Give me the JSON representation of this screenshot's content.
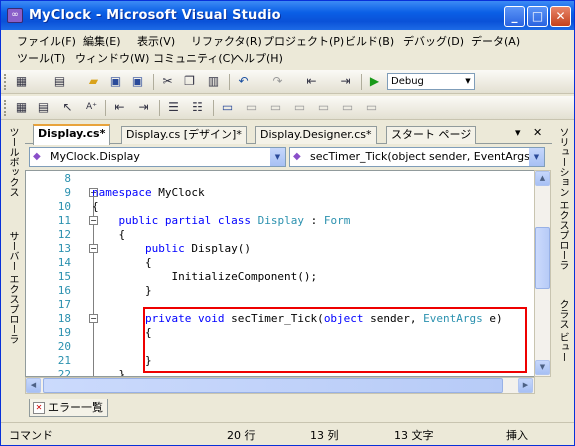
{
  "window": {
    "title": "MyClock - Microsoft Visual Studio",
    "minimize": "_",
    "maximize": "□",
    "close": "✕"
  },
  "menu": {
    "row1": [
      "ファイル(F)",
      "編集(E)",
      "表示(V)",
      "リファクタ(R)",
      "プロジェクト(P)",
      "ビルド(B)",
      "デバッグ(D)",
      "データ(A)"
    ],
    "row2": [
      "ツール(T)",
      "ウィンドウ(W)",
      "コミュニティ(C)",
      "ヘルプ(H)"
    ]
  },
  "toolbar": {
    "configuration": "Debug"
  },
  "tabs": [
    {
      "label": "Display.cs*",
      "active": true
    },
    {
      "label": "Display.cs [デザイン]*",
      "active": false
    },
    {
      "label": "Display.Designer.cs*",
      "active": false
    },
    {
      "label": "スタート ページ",
      "active": false
    }
  ],
  "tab_controls": {
    "dropdown": "▾",
    "close": "✕"
  },
  "navigation": {
    "type_combo": "MyClock.Display",
    "member_combo": "secTimer_Tick(object sender, EventArgs e)"
  },
  "left_panel_tabs": [
    "ツールボックス",
    "サーバー エクスプローラ"
  ],
  "right_panel_tabs": [
    "ソリューション エクスプローラ",
    "クラス ビュー"
  ],
  "code": {
    "line_numbers": [
      "8",
      "9",
      "10",
      "11",
      "12",
      "13",
      "14",
      "15",
      "16",
      "17",
      "18",
      "19",
      "20",
      "21",
      "22"
    ],
    "lines": [
      "",
      "namespace MyClock",
      "{",
      "    public partial class Display : Form",
      "    {",
      "        public Display()",
      "        {",
      "            InitializeComponent();",
      "        }",
      "",
      "        private void secTimer_Tick(object sender, EventArgs e)",
      "        {",
      "",
      "        }",
      "    }"
    ]
  },
  "bottom_panel": {
    "error_list_tab": "エラー一覧"
  },
  "status": {
    "message": "コマンド",
    "line": "20 行",
    "column": "13 列",
    "char": "13 文字",
    "mode": "挿入"
  }
}
